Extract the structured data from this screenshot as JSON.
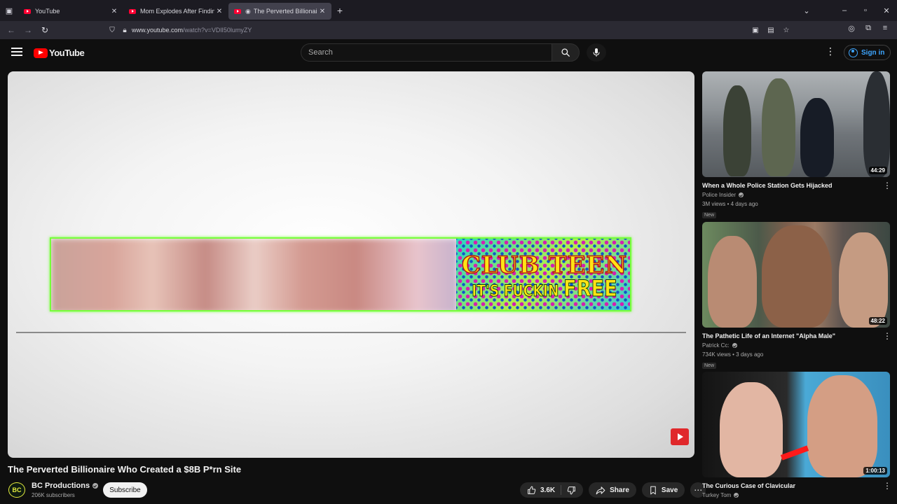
{
  "browser": {
    "tabs": [
      {
        "label": "YouTube",
        "active": false
      },
      {
        "label": "Mom Explodes After Finding O",
        "active": false
      },
      {
        "label": "The Perverted Billionaire W",
        "active": true
      }
    ],
    "url_domain": "www.youtube.com",
    "url_path": "/watch?v=VDlI50lumyZY"
  },
  "header": {
    "logo_text": "YouTube",
    "search_placeholder": "Search",
    "signin_label": "Sign in"
  },
  "player": {
    "ad_line1": "CLUB TEEN",
    "ad_line2_a": "IT'S FUCKIN ",
    "ad_line2_b": "FREE"
  },
  "video": {
    "title": "The Perverted Billionaire Who Created a $8B P*rn Site",
    "channel_name": "BC Productions",
    "channel_initials": "BC",
    "subscribers": "206K subscribers",
    "subscribe_label": "Subscribe",
    "likes": "3.6K",
    "share_label": "Share",
    "save_label": "Save"
  },
  "recommendations": [
    {
      "title": "When a Whole Police Station Gets Hijacked",
      "channel": "Police Insider",
      "meta": "3M views • 4 days ago",
      "badge": "New",
      "duration": "44:29"
    },
    {
      "title": "The Pathetic Life of an Internet \"Alpha Male\"",
      "channel": "Patrick Cc:",
      "meta": "734K views • 3 days ago",
      "badge": "New",
      "duration": "48:22"
    },
    {
      "title": "The Curious Case of Clavicular",
      "channel": "Turkey Tom",
      "meta": "",
      "badge": "",
      "duration": "1:00:13"
    }
  ],
  "colors": {
    "background": "#0f0f0f",
    "youtube_red": "#ff0000",
    "link_blue": "#3ea6ff",
    "banner_border": "#76ff3a"
  },
  "icons": [
    "tab-list-icon",
    "close-icon",
    "plus-icon",
    "chevron-down-icon",
    "minimize-icon",
    "maximize-icon",
    "back-arrow-icon",
    "forward-arrow-icon",
    "reload-icon",
    "shield-icon",
    "lock-icon",
    "star-icon",
    "account-icon",
    "extensions-icon",
    "menu-icon",
    "search-icon",
    "mic-icon",
    "thumbs-up-icon",
    "thumbs-down-icon",
    "share-icon",
    "bookmark-icon",
    "more-icon"
  ]
}
